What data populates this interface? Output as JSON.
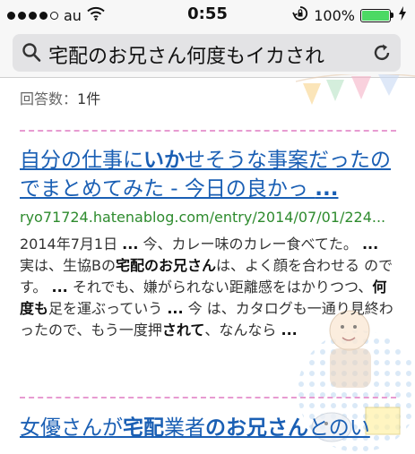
{
  "status_bar": {
    "carrier": "au",
    "time": "0:55",
    "battery_percent": "100%",
    "battery_level": 1.0,
    "battery_color": "#4cd964",
    "signal_bars_filled": 4,
    "signal_bars_total": 5,
    "icons": [
      "wifi-icon",
      "rotation-lock-icon",
      "charging-icon"
    ]
  },
  "url_bar": {
    "query": "宅配のお兄さん何度もイカされ",
    "search_icon": "search-icon",
    "reload_icon": "reload-icon"
  },
  "results": {
    "answer_count_label": "回答数：",
    "answer_count_value": "1件",
    "items": [
      {
        "title_parts": [
          "自分の仕事に",
          "いか",
          "せそうな事案だったのでまとめてみた - 今日の良かっ ",
          "..."
        ],
        "url": "ryo71724.hatenablog.com/entry/2014/07/01/224...",
        "snippet_parts": [
          "2014年7月1日 ",
          "...",
          " 今、カレー味のカレー食べてた。 ",
          "...",
          " 実は、生協Bの",
          "宅配",
          "の",
          "お兄さん",
          "は、よく顔を合わせる のです。 ",
          "...",
          " それでも、嫌がられない距離感をはかりつつ、",
          "何度も",
          "足を運ぶっていう ",
          "...",
          " 今 は、カタログも一通り見終わったので、もう一度押",
          "されて",
          "、なんなら ",
          "..."
        ]
      },
      {
        "title_parts": [
          "女優さんが",
          "宅配",
          "業者",
          "のお兄さん",
          "とのい"
        ]
      }
    ]
  },
  "colors": {
    "link": "#1a5fb4",
    "url_green": "#2e8b2e",
    "separator": "#e79bd1"
  }
}
